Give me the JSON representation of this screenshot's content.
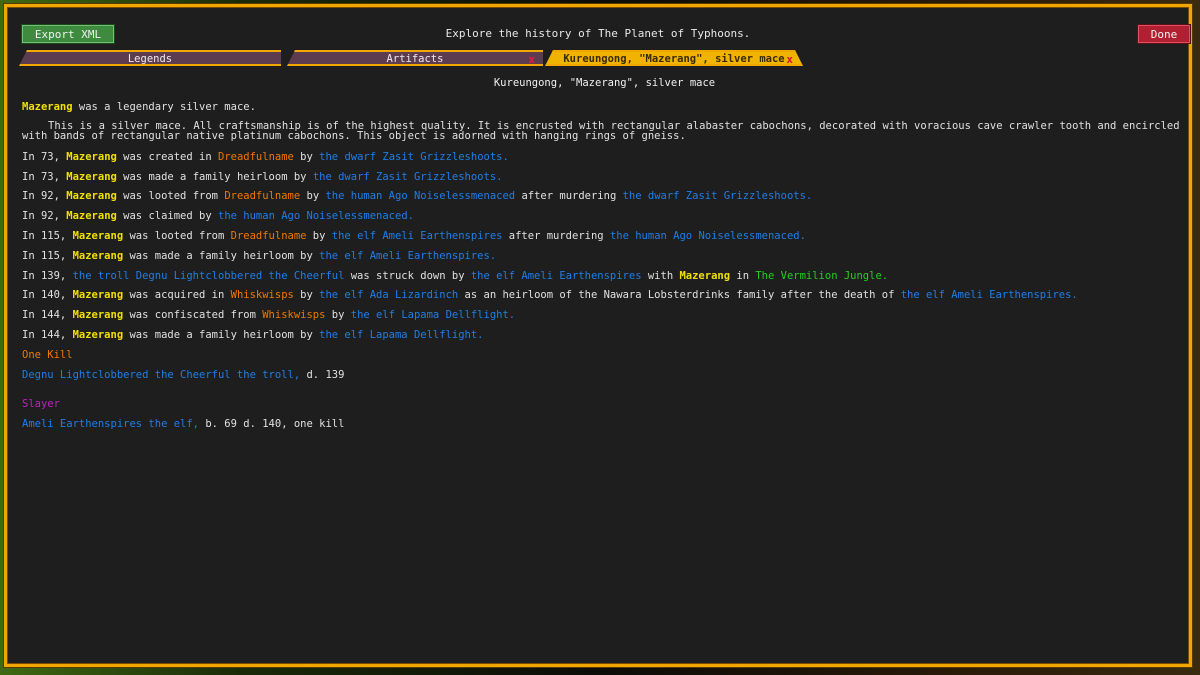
{
  "header": {
    "export_label": "Export XML",
    "title": "Explore the history of The Planet of Typhoons.",
    "done_label": "Done"
  },
  "tabs": [
    {
      "label": "Legends",
      "active": false
    },
    {
      "label": "Artifacts",
      "active": false,
      "close": "x"
    },
    {
      "label": "Kureungong, \"Mazerang\", silver mace",
      "active": true,
      "close": "x"
    }
  ],
  "colors": {
    "artifact": "#f0e000",
    "site": "#f07800",
    "figure": "#1e7ee8",
    "region": "#20d020",
    "slayer": "#c020c0",
    "frame": "#f0a800"
  },
  "page": {
    "heading": "Kureungong, \"Mazerang\", silver mace",
    "intro": {
      "name": "Mazerang",
      "rest": " was a legendary silver mace."
    },
    "description": "This is a silver mace. All craftsmanship is of the highest quality. It is encrusted with rectangular alabaster cabochons, decorated with voracious cave crawler tooth and encircled with bands of rectangular native platinum cabochons. This object is adorned with hanging rings of gneiss.",
    "events": [
      [
        {
          "t": "In 73, "
        },
        {
          "t": "Mazerang",
          "c": "y"
        },
        {
          "t": " was created in "
        },
        {
          "t": "Dreadfulname",
          "c": "o"
        },
        {
          "t": " by "
        },
        {
          "t": "the dwarf Zasit Grizzleshoots.",
          "c": "b"
        }
      ],
      [
        {
          "t": "In 73, "
        },
        {
          "t": "Mazerang",
          "c": "y"
        },
        {
          "t": " was made a family heirloom by "
        },
        {
          "t": "the dwarf Zasit Grizzleshoots.",
          "c": "b"
        }
      ],
      [
        {
          "t": "In 92, "
        },
        {
          "t": "Mazerang",
          "c": "y"
        },
        {
          "t": " was looted from "
        },
        {
          "t": "Dreadfulname",
          "c": "o"
        },
        {
          "t": " by "
        },
        {
          "t": "the human Ago Noiselessmenaced",
          "c": "b"
        },
        {
          "t": " after murdering "
        },
        {
          "t": "the dwarf Zasit Grizzleshoots.",
          "c": "b"
        }
      ],
      [
        {
          "t": "In 92, "
        },
        {
          "t": "Mazerang",
          "c": "y"
        },
        {
          "t": " was claimed by "
        },
        {
          "t": "the human Ago Noiselessmenaced.",
          "c": "b"
        }
      ],
      [
        {
          "t": "In 115, "
        },
        {
          "t": "Mazerang",
          "c": "y"
        },
        {
          "t": " was looted from "
        },
        {
          "t": "Dreadfulname",
          "c": "o"
        },
        {
          "t": " by "
        },
        {
          "t": "the elf Ameli Earthenspires",
          "c": "b"
        },
        {
          "t": " after murdering "
        },
        {
          "t": "the human Ago Noiselessmenaced.",
          "c": "b"
        }
      ],
      [
        {
          "t": "In 115, "
        },
        {
          "t": "Mazerang",
          "c": "y"
        },
        {
          "t": " was made a family heirloom by "
        },
        {
          "t": "the elf Ameli Earthenspires.",
          "c": "b"
        }
      ],
      [
        {
          "t": "In 139, "
        },
        {
          "t": "the troll Degnu Lightclobbered the Cheerful",
          "c": "b"
        },
        {
          "t": " was struck down by "
        },
        {
          "t": "the elf Ameli Earthenspires",
          "c": "b"
        },
        {
          "t": " with "
        },
        {
          "t": "Mazerang",
          "c": "y"
        },
        {
          "t": " in "
        },
        {
          "t": "The Vermilion Jungle.",
          "c": "g"
        }
      ],
      [
        {
          "t": "In 140, "
        },
        {
          "t": "Mazerang",
          "c": "y"
        },
        {
          "t": " was acquired in "
        },
        {
          "t": "Whiskwisps",
          "c": "o"
        },
        {
          "t": " by "
        },
        {
          "t": "the elf Ada Lizardinch",
          "c": "b"
        },
        {
          "t": " as an heirloom of the Nawara Lobsterdrinks family after the death of "
        },
        {
          "t": "the elf Ameli Earthenspires.",
          "c": "b"
        }
      ],
      [
        {
          "t": "In 144, "
        },
        {
          "t": "Mazerang",
          "c": "y"
        },
        {
          "t": " was confiscated from "
        },
        {
          "t": "Whiskwisps",
          "c": "o"
        },
        {
          "t": " by "
        },
        {
          "t": "the elf Lapama Dellflight.",
          "c": "b"
        }
      ],
      [
        {
          "t": "In 144, "
        },
        {
          "t": "Mazerang",
          "c": "y"
        },
        {
          "t": " was made a family heirloom by "
        },
        {
          "t": "the elf Lapama Dellflight.",
          "c": "b"
        }
      ]
    ],
    "kills": {
      "heading": "One Kill",
      "entry_name": "Degnu Lightclobbered the Cheerful the troll,",
      "entry_rest": " d. 139"
    },
    "slayer": {
      "heading": "Slayer",
      "entry_name": "Ameli Earthenspires the elf,",
      "entry_rest": " b. 69 d. 140, one kill"
    }
  }
}
